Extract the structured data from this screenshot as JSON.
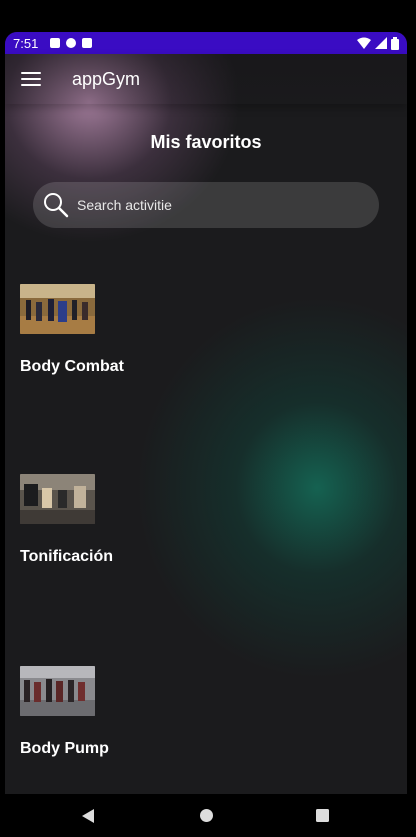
{
  "status_bar": {
    "time": "7:51"
  },
  "app_bar": {
    "title": "appGym"
  },
  "page": {
    "title": "Mis favoritos"
  },
  "search": {
    "placeholder": "Search activitie",
    "value": ""
  },
  "activities": [
    {
      "name": "Body Combat",
      "image": "group-fitness-class-photo"
    },
    {
      "name": "Tonificación",
      "image": "toning-class-photo"
    },
    {
      "name": "Body Pump",
      "image": "body-pump-class-photo"
    }
  ],
  "colors": {
    "status_bar": "#3a0cc3",
    "background": "#1b1b1d",
    "accent_pink": "#cd9bc3",
    "accent_green": "#146e5a"
  }
}
